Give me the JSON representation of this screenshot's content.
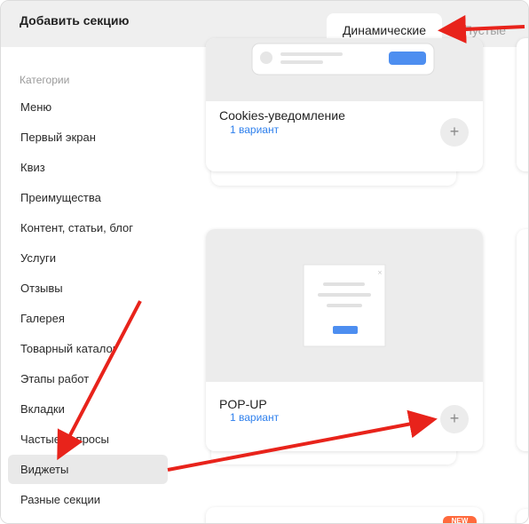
{
  "header": {
    "title": "Добавить секцию",
    "tabs": [
      {
        "label": "Динамические",
        "active": true
      },
      {
        "label": "Пустые",
        "active": false
      }
    ]
  },
  "sidebar": {
    "heading": "Категории",
    "items": [
      {
        "label": "Меню"
      },
      {
        "label": "Первый экран"
      },
      {
        "label": "Квиз"
      },
      {
        "label": "Преимущества"
      },
      {
        "label": "Контент, статьи, блог"
      },
      {
        "label": "Услуги"
      },
      {
        "label": "Отзывы"
      },
      {
        "label": "Галерея"
      },
      {
        "label": "Товарный каталог"
      },
      {
        "label": "Этапы работ"
      },
      {
        "label": "Вкладки"
      },
      {
        "label": "Частые вопросы"
      },
      {
        "label": "Виджеты",
        "active": true
      },
      {
        "label": "Разные секции"
      }
    ]
  },
  "cards": [
    {
      "name": "Cookies-уведомление",
      "variants": "1 вариант",
      "add_icon": "plus-icon"
    },
    {
      "name": "POP-UP",
      "variants": "1 вариант",
      "add_icon": "plus-icon"
    }
  ],
  "badge": {
    "label": "NEW"
  },
  "colors": {
    "accent": "#2f80ed",
    "annotation": "#e8231b",
    "badge": "#ff6a3d",
    "preview_button": "#4d8ef0"
  }
}
